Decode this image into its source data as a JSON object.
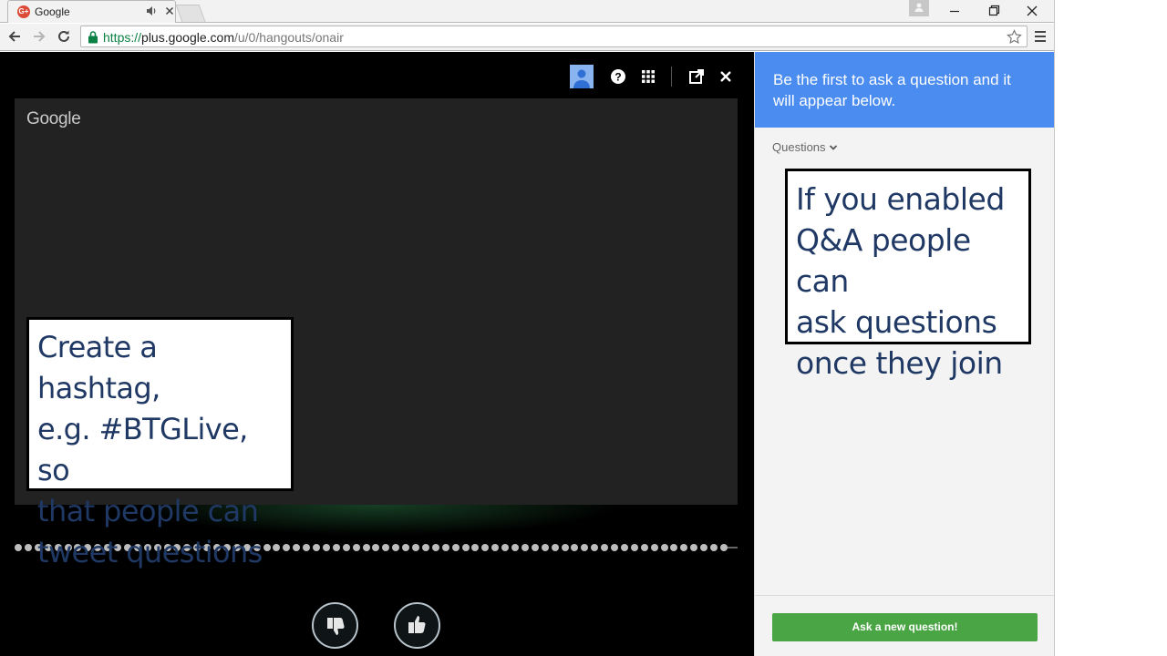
{
  "browser": {
    "tab_title": "Google",
    "url_scheme": "https://",
    "url_host": "plus.google.com",
    "url_path": "/u/0/hangouts/onair",
    "icons": [
      "google-plus-favicon",
      "audio-icon",
      "close-icon",
      "user-icon",
      "minimize-icon",
      "restore-icon",
      "close-icon",
      "back-icon",
      "forward-icon",
      "reload-icon",
      "lock-icon",
      "star-icon",
      "menu-icon"
    ]
  },
  "hangout": {
    "logo_text": "Google",
    "top_icons": [
      "avatar-icon",
      "help-icon",
      "apps-grid-icon",
      "popout-icon",
      "close-icon"
    ],
    "vote_buttons": [
      "thumbs-down-icon",
      "thumbs-up-icon"
    ],
    "colors": {
      "stage": "#000000",
      "video": "#222222",
      "dots": "#bdbdbd"
    }
  },
  "annotations": {
    "left_callout": [
      "Create a hashtag,",
      "e.g. #BTGLive, so",
      "that people can",
      "tweet questions"
    ],
    "right_callout": [
      "If you enabled",
      "Q&A people can",
      "ask questions",
      "once they join"
    ]
  },
  "qa": {
    "banner_line1": "Be the first to ask a question and it",
    "banner_line2": "will appear below.",
    "filter_label": "Questions",
    "ask_button": "Ask a new question!",
    "colors": {
      "banner": "#4a8cf0",
      "ask_button": "#4aa544"
    }
  }
}
